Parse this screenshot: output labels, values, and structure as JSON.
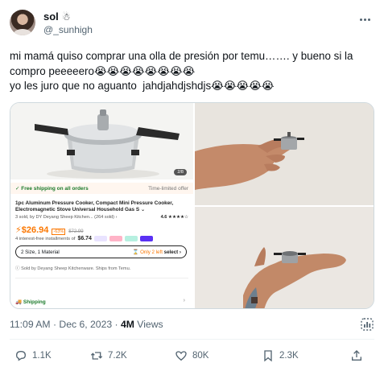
{
  "author": {
    "display_name": "sol",
    "name_emoji": "☃",
    "handle": "@_sunhigh"
  },
  "tweet": {
    "text": "mi mamá quiso comprar una olla de presión por temu……. y bueno si la compro peeeeero😭😭😭😭😭😭😭😭\nyo les juro que no aguanto  jahdjahdjshdjs😭😭😭😭😭"
  },
  "product": {
    "image_counter": "2/8",
    "shipping_banner": "✓ Free shipping on all orders",
    "limited_offer": "Time-limited offer",
    "title": "1pc Aluminum Pressure Cooker, Compact Mini Pressure Cooker, Electromagnetic Stove Universal Household Gas S ⌄",
    "sold": "3 sold, by DY Deyang Sheep Kitchen... (264 sold) ›",
    "rating": "4.6 ★★★★☆",
    "price": "⚡$26.94",
    "discount": "-63%",
    "old_price": "$72.99",
    "installments_prefix": "4 interest-free installments of",
    "installment_amount": "$6.74",
    "size": "2 Size, 1 Material",
    "stock_warning": "⌛ Only 2 left",
    "select_label": "select ›",
    "seller_note": "ⓘ Sold by Deyang Sheep Kitchenware. Ships from Temu.",
    "shipping_label": "🚚 Shipping",
    "shipping_arrow": "›"
  },
  "meta": {
    "time_date": "11:09 AM · Dec 6, 2023 · ",
    "views_count": "4M",
    "views_label": " Views"
  },
  "actions": {
    "replies": "1.1K",
    "retweets": "7.2K",
    "likes": "80K",
    "bookmarks": "2.3K"
  },
  "colors": {
    "temu_orange": "#fb7701",
    "secondary_text": "#536471",
    "primary_text": "#0f1419"
  }
}
